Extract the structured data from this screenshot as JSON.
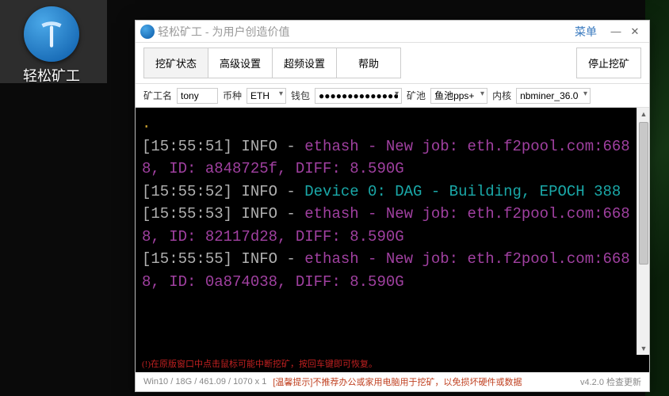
{
  "desktop": {
    "icon_label": "轻松矿工"
  },
  "window": {
    "title": "轻松矿工 - 为用户创造价值",
    "menu_label": "菜单"
  },
  "tabs": {
    "mining_status": "挖矿状态",
    "advanced": "高级设置",
    "overclock": "超频设置",
    "help": "帮助",
    "stop": "停止挖矿"
  },
  "params": {
    "miner_label": "矿工名",
    "miner_value": "tony",
    "coin_label": "币种",
    "coin_value": "ETH",
    "wallet_label": "钱包",
    "wallet_value": "●●●●●●●●●●●●●●",
    "pool_label": "矿池",
    "pool_value": "鱼池pps+",
    "kernel_label": "内核",
    "kernel_value": "nbminer_36.0"
  },
  "console_lines": [
    {
      "segments": [
        {
          "cls": "c-grey",
          "text": "[15:55:51] INFO - "
        },
        {
          "cls": "c-purple",
          "text": "ethash - New job: eth.f2pool.com:6688, ID: a848725f, DIFF: 8.590G"
        }
      ]
    },
    {
      "segments": [
        {
          "cls": "c-grey",
          "text": "[15:55:52] INFO - "
        },
        {
          "cls": "c-teal",
          "text": "Device 0: DAG - Building, EPOCH 388"
        }
      ]
    },
    {
      "segments": [
        {
          "cls": "c-grey",
          "text": "[15:55:53] INFO - "
        },
        {
          "cls": "c-purple",
          "text": "ethash - New job: eth.f2pool.com:6688, ID: 82117d28, DIFF: 8.590G"
        }
      ]
    },
    {
      "segments": [
        {
          "cls": "c-grey",
          "text": "[15:55:55] INFO - "
        },
        {
          "cls": "c-purple",
          "text": "ethash - New job: eth.f2pool.com:6688, ID: 0a874038, DIFF: 8.590G"
        }
      ]
    }
  ],
  "console_tip": "(!)在原版窗口中点击鼠标可能中断挖矿，按回车键即可恢复。",
  "status": {
    "sys": "Win10  /  18G / 461.09 / 1070 x 1",
    "warn": "[温馨提示]不推荐办公或家用电脑用于挖矿，以免损坏硬件或数据",
    "version": "v4.2.0 检查更新"
  }
}
